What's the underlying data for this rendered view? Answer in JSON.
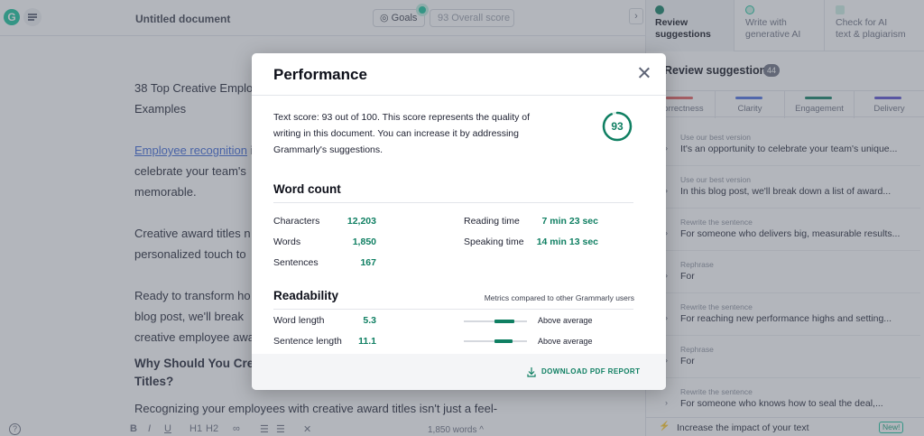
{
  "editor": {
    "doc_title": "Untitled document",
    "goals_label": "Goals",
    "overall_score": "93 Overall score",
    "paragraphs": {
      "p1a": "38 Top Creative Emplo",
      "p1b": "Examples",
      "p2_link": "Employee recognition",
      "p2_rest": " i",
      "p2b": "celebrate your team's",
      "p2c": "memorable.",
      "p3a": "Creative award titles n",
      "p3b": "personalized touch to",
      "p4a": "Ready to transform ho",
      "p4b": "blog post, we'll break",
      "p4c": "creative employee awa",
      "h1": "Why Should You Cre",
      "h2": "Titles?",
      "p5": "Recognizing your employees with creative award titles isn't just a feel-"
    },
    "bottom": {
      "help": "?",
      "format_tools": [
        "B",
        "I",
        "U",
        "H1",
        "H2",
        "∞",
        "☰",
        "☰",
        "✕"
      ],
      "word_count": "1,850 words"
    }
  },
  "panel": {
    "tabs": [
      {
        "line1": "Review",
        "line2": "suggestions"
      },
      {
        "line1": "Write with",
        "line2": "generative AI"
      },
      {
        "line1": "Check for AI",
        "line2": "text & plagiarism"
      }
    ],
    "title": "Review suggestions",
    "count": "44",
    "categories": [
      {
        "label": "Correctness",
        "color": "#e45d5d"
      },
      {
        "label": "Clarity",
        "color": "#4a6ee0"
      },
      {
        "label": "Engagement",
        "color": "#0f7f62"
      },
      {
        "label": "Delivery",
        "color": "#5a4fcf"
      }
    ],
    "suggestions": [
      {
        "kind": "Use our best version",
        "text": "It's an opportunity to celebrate your team's unique..."
      },
      {
        "kind": "Use our best version",
        "text": "In this blog post, we'll break down a list of award..."
      },
      {
        "kind": "Rewrite the sentence",
        "text": "For someone who delivers big, measurable results..."
      },
      {
        "kind": "Rephrase",
        "text": "For"
      },
      {
        "kind": "Rewrite the sentence",
        "text": "For reaching new performance highs and setting..."
      },
      {
        "kind": "Rephrase",
        "text": "For"
      },
      {
        "kind": "Rewrite the sentence",
        "text": "For someone who knows how to seal the deal,..."
      }
    ],
    "impact_text": "Increase the impact of your text",
    "impact_badge": "New!"
  },
  "modal": {
    "title": "Performance",
    "description": "Text score: 93 out of 100. This score represents the quality of writing in this document. You can increase it by addressing Grammarly's suggestions.",
    "score": "93",
    "score_value": 0.93,
    "word_count_title": "Word count",
    "word_stats": [
      {
        "label": "Characters",
        "value": "12,203"
      },
      {
        "label": "Words",
        "value": "1,850"
      },
      {
        "label": "Sentences",
        "value": "167"
      }
    ],
    "time_stats": [
      {
        "label": "Reading time",
        "value": "7 min 23 sec"
      },
      {
        "label": "Speaking time",
        "value": "14 min 13 sec"
      }
    ],
    "readability_title": "Readability",
    "readability_note": "Metrics compared to other Grammarly users",
    "readability": [
      {
        "label": "Word length",
        "value": "5.3",
        "comparison": "Above average"
      },
      {
        "label": "Sentence length",
        "value": "11.1",
        "comparison": "Above average"
      }
    ],
    "download_label": "DOWNLOAD PDF REPORT"
  },
  "colors": {
    "brand": "#15c39a",
    "accent": "#0f7f62"
  }
}
